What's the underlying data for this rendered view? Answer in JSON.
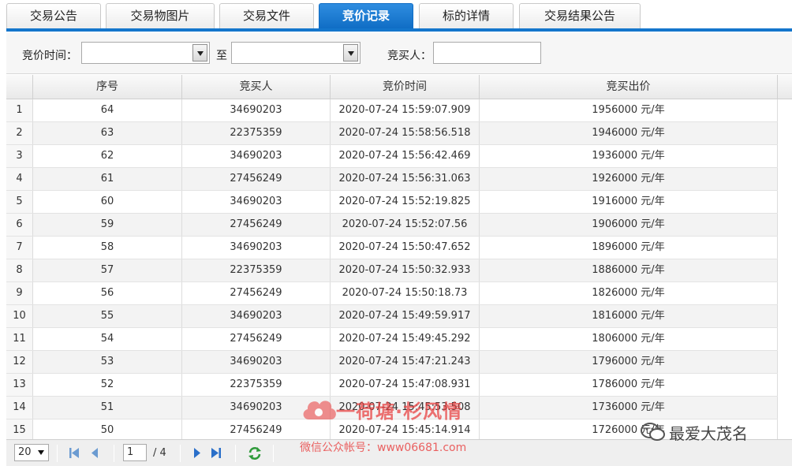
{
  "tabs": [
    {
      "label": "交易公告"
    },
    {
      "label": "交易物图片"
    },
    {
      "label": "交易文件"
    },
    {
      "label": "竞价记录"
    },
    {
      "label": "标的详情"
    },
    {
      "label": "交易结果公告"
    }
  ],
  "filter": {
    "time_label": "竞价时间：",
    "to_label": "至",
    "buyer_label": "竞买人："
  },
  "table": {
    "headers": [
      "序号",
      "竞买人",
      "竞价时间",
      "竞买出价"
    ],
    "rows": [
      {
        "n": "1",
        "seq": "64",
        "buyer": "34690203",
        "time": "2020-07-24 15:59:07.909",
        "price": "1956000 元/年"
      },
      {
        "n": "2",
        "seq": "63",
        "buyer": "22375359",
        "time": "2020-07-24 15:58:56.518",
        "price": "1946000 元/年"
      },
      {
        "n": "3",
        "seq": "62",
        "buyer": "34690203",
        "time": "2020-07-24 15:56:42.469",
        "price": "1936000 元/年"
      },
      {
        "n": "4",
        "seq": "61",
        "buyer": "27456249",
        "time": "2020-07-24 15:56:31.063",
        "price": "1926000 元/年"
      },
      {
        "n": "5",
        "seq": "60",
        "buyer": "34690203",
        "time": "2020-07-24 15:52:19.825",
        "price": "1916000 元/年"
      },
      {
        "n": "6",
        "seq": "59",
        "buyer": "27456249",
        "time": "2020-07-24 15:52:07.56",
        "price": "1906000 元/年"
      },
      {
        "n": "7",
        "seq": "58",
        "buyer": "34690203",
        "time": "2020-07-24 15:50:47.652",
        "price": "1896000 元/年"
      },
      {
        "n": "8",
        "seq": "57",
        "buyer": "22375359",
        "time": "2020-07-24 15:50:32.933",
        "price": "1886000 元/年"
      },
      {
        "n": "9",
        "seq": "56",
        "buyer": "27456249",
        "time": "2020-07-24 15:50:18.73",
        "price": "1826000 元/年"
      },
      {
        "n": "10",
        "seq": "55",
        "buyer": "34690203",
        "time": "2020-07-24 15:49:59.917",
        "price": "1816000 元/年"
      },
      {
        "n": "11",
        "seq": "54",
        "buyer": "27456249",
        "time": "2020-07-24 15:49:45.292",
        "price": "1806000 元/年"
      },
      {
        "n": "12",
        "seq": "53",
        "buyer": "34690203",
        "time": "2020-07-24 15:47:21.243",
        "price": "1796000 元/年"
      },
      {
        "n": "13",
        "seq": "52",
        "buyer": "22375359",
        "time": "2020-07-24 15:47:08.931",
        "price": "1786000 元/年"
      },
      {
        "n": "14",
        "seq": "51",
        "buyer": "34690203",
        "time": "2020-07-24 15:45:53.508",
        "price": "1736000 元/年"
      },
      {
        "n": "15",
        "seq": "50",
        "buyer": "27456249",
        "time": "2020-07-24 15:45:14.914",
        "price": "1726000 元/年"
      }
    ]
  },
  "pager": {
    "page_size": "20",
    "current_page": "1",
    "total_text": "/ 4"
  },
  "watermark": {
    "site_title": "一荷塘·杉风情",
    "site_subtitle": "微信公众帐号：www06681.com",
    "channel": "最爱大茂名"
  },
  "colors": {
    "tab_active": "#1476cc",
    "watermark_red": "#e83c3c"
  }
}
